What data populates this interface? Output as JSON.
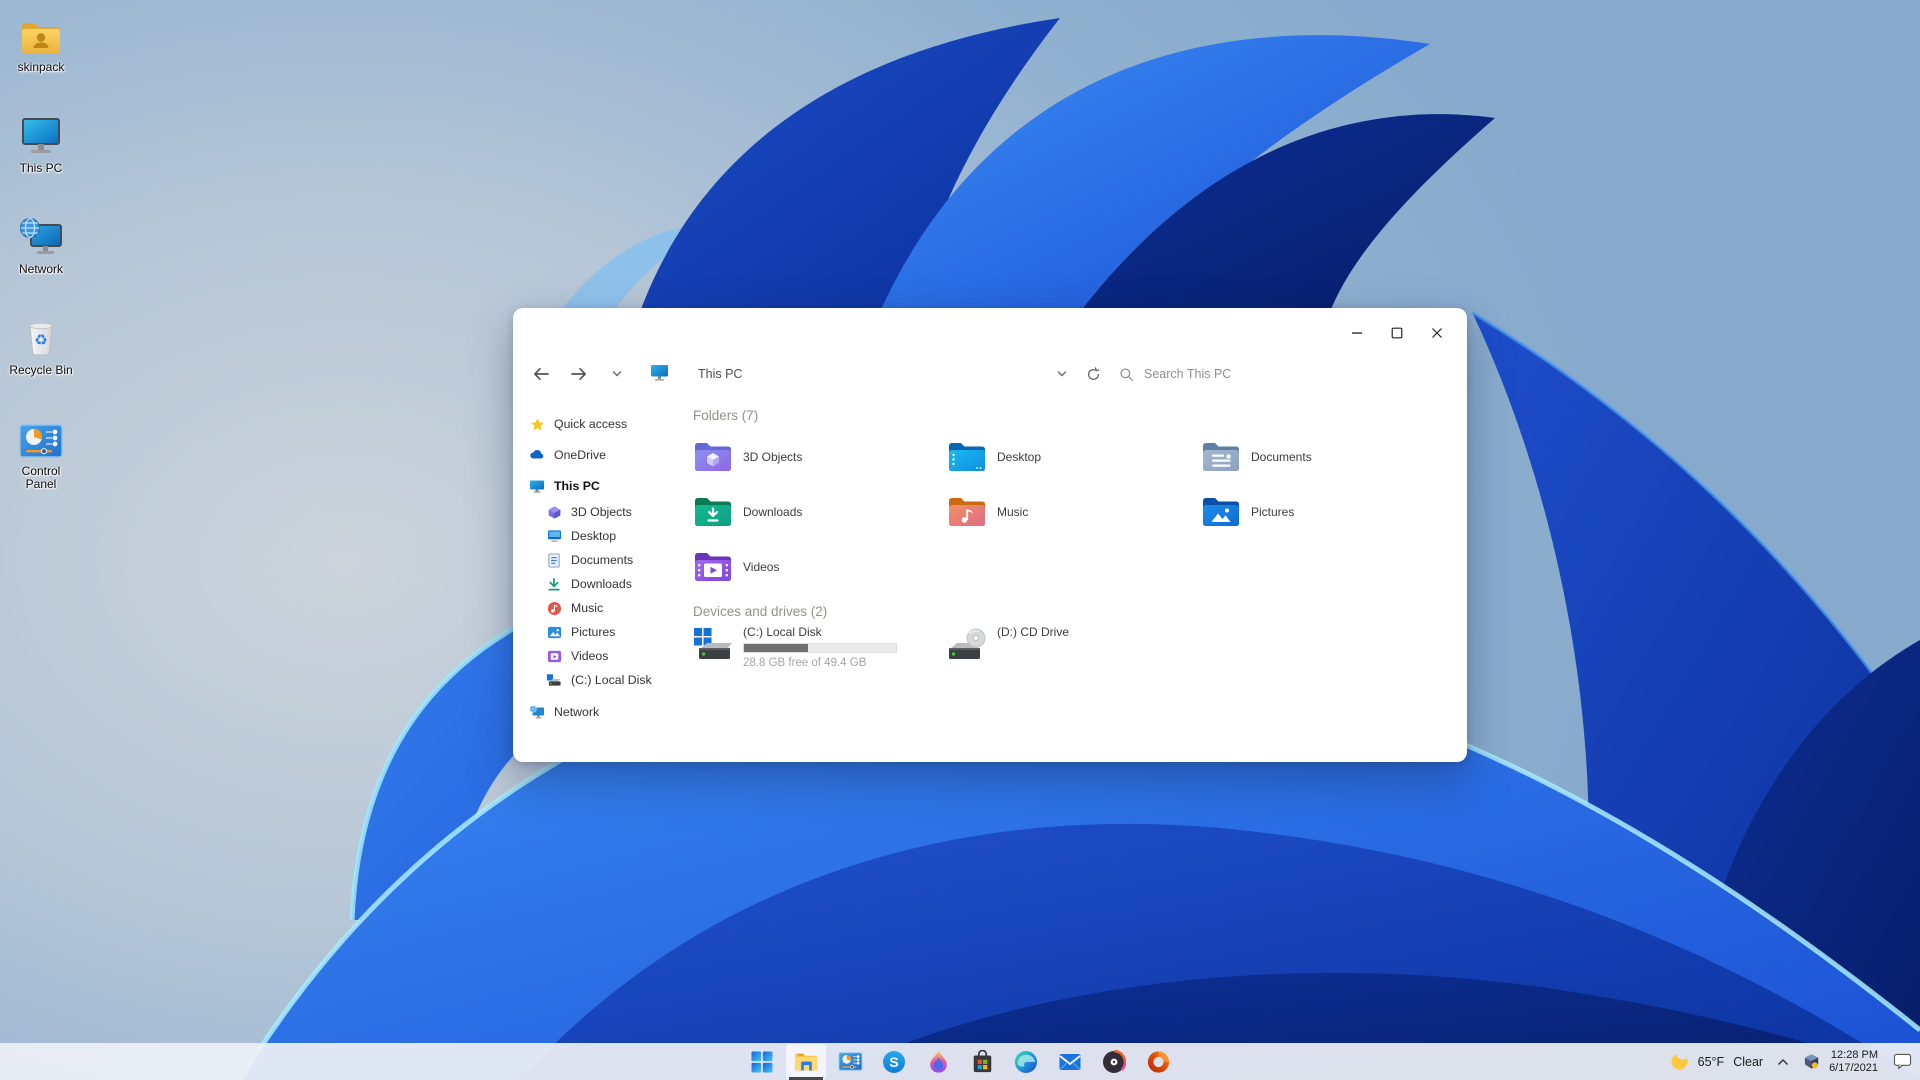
{
  "colors": {
    "accent": "#0078d4",
    "taskbar_bg": "#edf0f5",
    "window_bg": "#ffffff",
    "bloom_bright_blue": "#2f7ff2",
    "bloom_deep_blue": "#0a2f9a",
    "progress_fill": "#6f6f6f",
    "progress_track": "#e9e9e9"
  },
  "desktop": {
    "icons": [
      {
        "label": "skinpack"
      },
      {
        "label": "This PC"
      },
      {
        "label": "Network"
      },
      {
        "label": "Recycle Bin"
      },
      {
        "label": "Control Panel"
      }
    ],
    "recycle_glyph": "♻"
  },
  "window": {
    "nav": {
      "location": "This PC",
      "search_placeholder": "Search This PC"
    },
    "sidebar": {
      "items": [
        {
          "label": "Quick access"
        },
        {
          "label": "OneDrive"
        },
        {
          "label": "This PC"
        },
        {
          "label": "3D Objects"
        },
        {
          "label": "Desktop"
        },
        {
          "label": "Documents"
        },
        {
          "label": "Downloads"
        },
        {
          "label": "Music"
        },
        {
          "label": "Pictures"
        },
        {
          "label": "Videos"
        },
        {
          "label": "(C:) Local Disk"
        },
        {
          "label": "Network"
        }
      ]
    },
    "content": {
      "folders_header": "Folders (7)",
      "folders": [
        {
          "label": "3D Objects"
        },
        {
          "label": "Desktop"
        },
        {
          "label": "Documents"
        },
        {
          "label": "Downloads"
        },
        {
          "label": "Music"
        },
        {
          "label": "Pictures"
        },
        {
          "label": "Videos"
        }
      ],
      "devices_header": "Devices and drives (2)",
      "drives": [
        {
          "label": "(C:) Local Disk",
          "free_text": "28.8 GB free of 49.4 GB",
          "used_percent": 42
        },
        {
          "label": "(D:) CD Drive"
        }
      ]
    }
  },
  "taskbar": {
    "icons": [
      {
        "name": "start"
      },
      {
        "name": "file-explorer",
        "active": true
      },
      {
        "name": "control-panel"
      },
      {
        "name": "skype"
      },
      {
        "name": "paint-3d"
      },
      {
        "name": "microsoft-store"
      },
      {
        "name": "edge"
      },
      {
        "name": "mail"
      },
      {
        "name": "groove-music"
      },
      {
        "name": "office"
      }
    ],
    "skype_letter": "S",
    "tray": {
      "temperature": "65°F",
      "condition": "Clear",
      "time": "12:28 PM",
      "date": "6/17/2021"
    }
  }
}
